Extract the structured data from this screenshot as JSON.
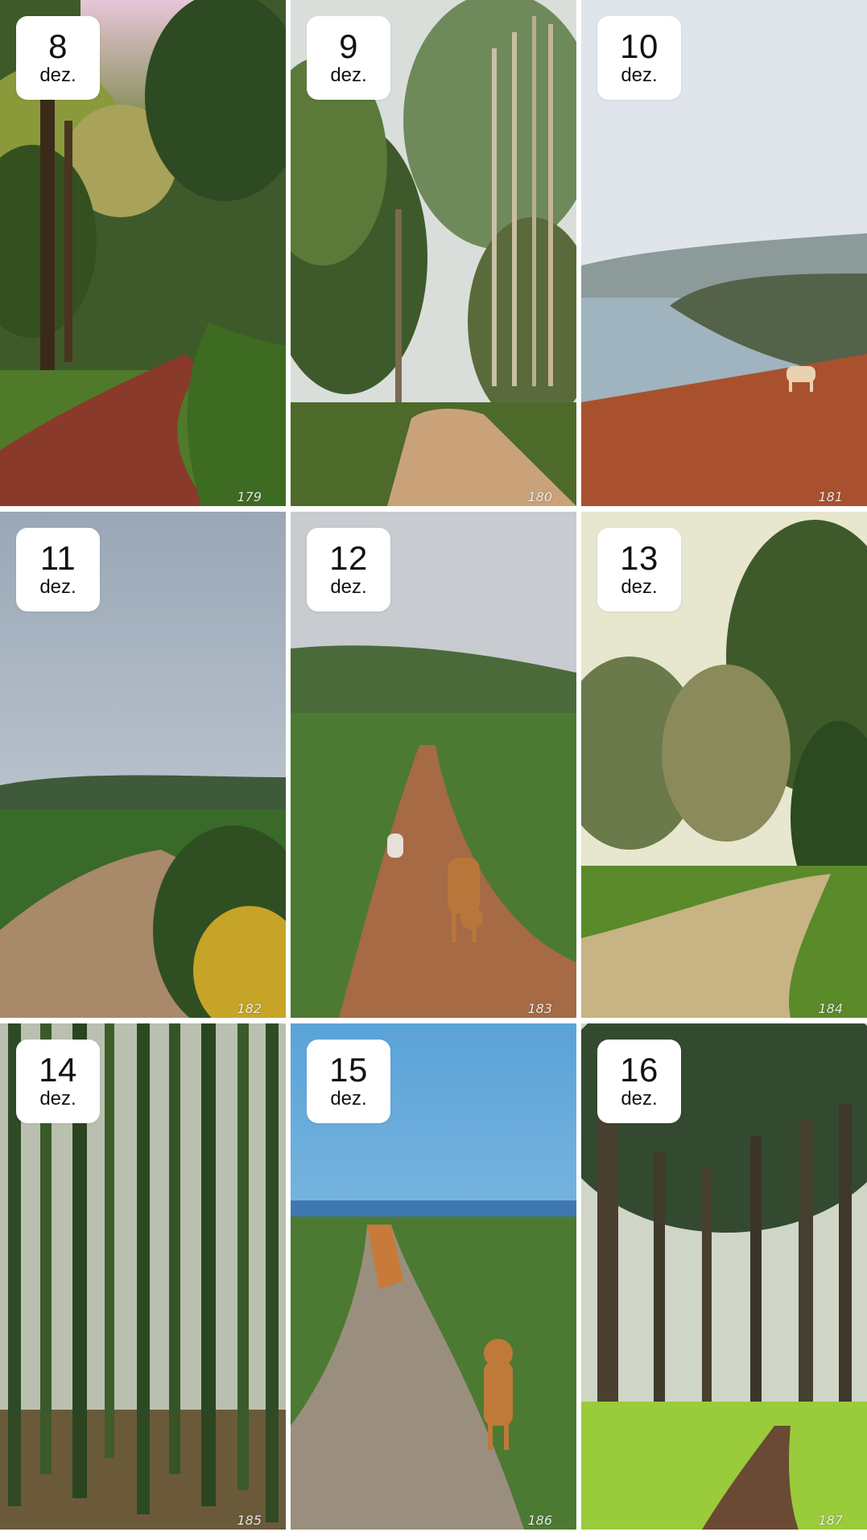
{
  "grid": {
    "cells": [
      {
        "day": "8",
        "month": "dez.",
        "photo_number": "179",
        "scene": "forest-path-red-dirt"
      },
      {
        "day": "9",
        "month": "dez.",
        "photo_number": "180",
        "scene": "eucalyptus-path"
      },
      {
        "day": "10",
        "month": "dez.",
        "photo_number": "181",
        "scene": "sea-cliff-with-dog"
      },
      {
        "day": "11",
        "month": "dez.",
        "photo_number": "182",
        "scene": "cloudy-hill-path"
      },
      {
        "day": "12",
        "month": "dez.",
        "photo_number": "183",
        "scene": "trail-with-dogs"
      },
      {
        "day": "13",
        "month": "dez.",
        "photo_number": "184",
        "scene": "sunlit-park-path"
      },
      {
        "day": "14",
        "month": "dez.",
        "photo_number": "185",
        "scene": "ivy-tree-forest"
      },
      {
        "day": "15",
        "month": "dez.",
        "photo_number": "186",
        "scene": "coastal-trail-dog"
      },
      {
        "day": "16",
        "month": "dez.",
        "photo_number": "187",
        "scene": "mossy-woodland"
      }
    ]
  },
  "colors": {
    "badge_background": "#ffffff",
    "badge_text": "#111111",
    "page_background": "#ffffff"
  }
}
